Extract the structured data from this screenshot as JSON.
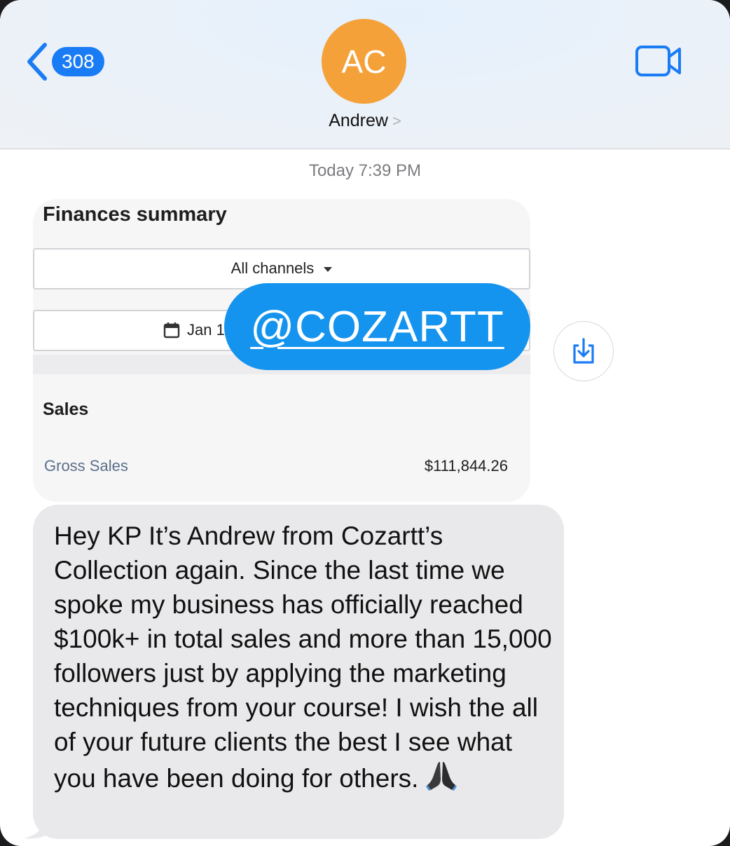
{
  "header": {
    "back_count": "308",
    "avatar_initials": "AC",
    "contact_name": "Andrew",
    "contact_chevron": ">"
  },
  "conversation": {
    "timestamp": "Today 7:39 PM",
    "attachment": {
      "title": "Finances summary",
      "channel_filter": "All channels",
      "date_filter": "Jan 1",
      "section": "Sales",
      "rows": [
        {
          "label": "Gross Sales",
          "value": "$111,844.26"
        }
      ]
    },
    "watermark": "@COZARTT",
    "message": "Hey KP It’s Andrew from Cozartt’s Collection again. Since the last time we spoke my business has officially reached $100k+ in total sales and more than 15,000 followers just by applying the marketing techniques from your course! I wish the all of your future clients the best I see what you have been doing for others."
  },
  "icons": {
    "back": "chevron-left-icon",
    "video": "video-camera-icon",
    "save": "save-download-icon",
    "calendar": "calendar-icon",
    "emoji": "folded-hands-emoji"
  },
  "colors": {
    "accent": "#1a7cf5",
    "avatar": "#f5a13a",
    "watermark": "#1494ee",
    "bubble": "#e9e9eb"
  }
}
